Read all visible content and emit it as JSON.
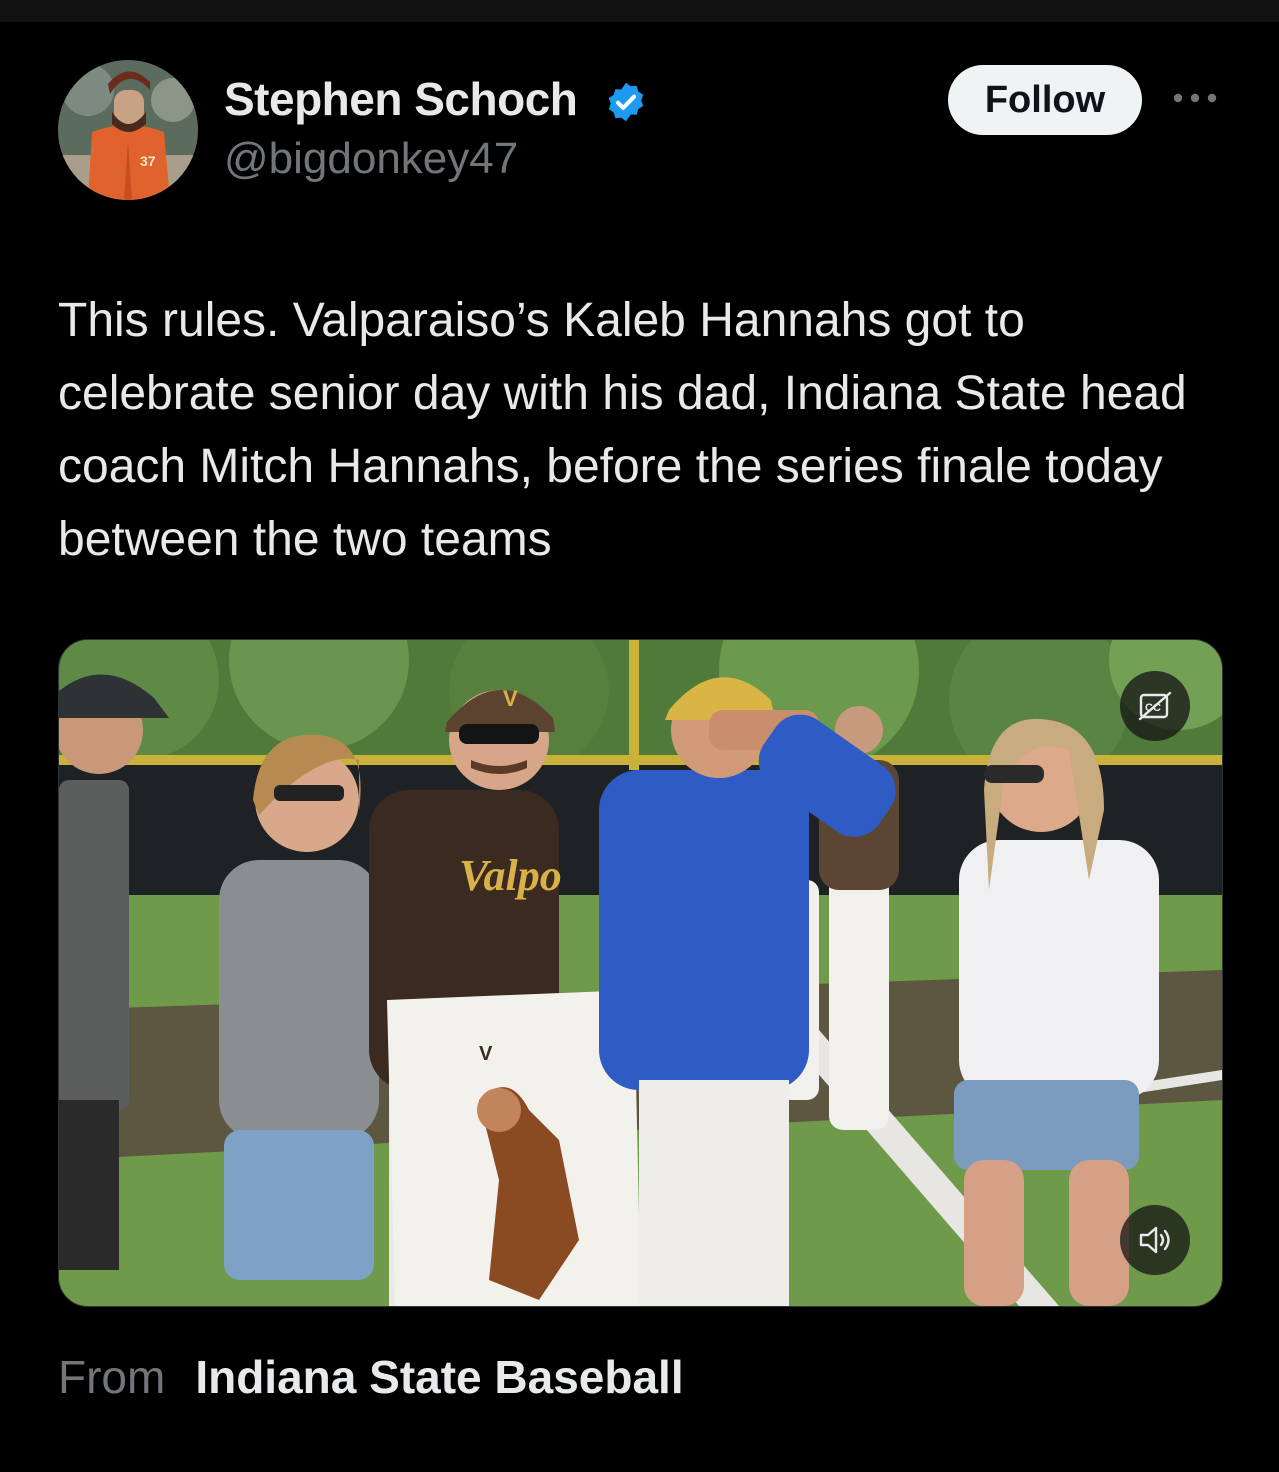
{
  "post": {
    "author": {
      "name": "Stephen Schoch",
      "handle": "@bigdonkey47",
      "verified": true,
      "avatar_jersey_number": "37"
    },
    "follow_label": "Follow",
    "text": "This rules. Valparaiso’s Kaleb Hannahs got to celebrate senior day with his dad, Indiana State head coach Mitch Hannahs, before the series finale today between the two teams",
    "media": {
      "type": "video",
      "captions_icon": "closed-captions-off-icon",
      "volume_icon": "speaker-muted-icon",
      "jersey_text": "Valpo",
      "cap_letter": "V",
      "poster_letter": "V"
    },
    "source": {
      "prefix": "From",
      "name": "Indiana State Baseball"
    }
  },
  "colors": {
    "background": "#000000",
    "text_primary": "#e7e9ea",
    "text_secondary": "#71767b",
    "verified_blue": "#1d9bf0",
    "follow_bg": "#eff3f4"
  }
}
